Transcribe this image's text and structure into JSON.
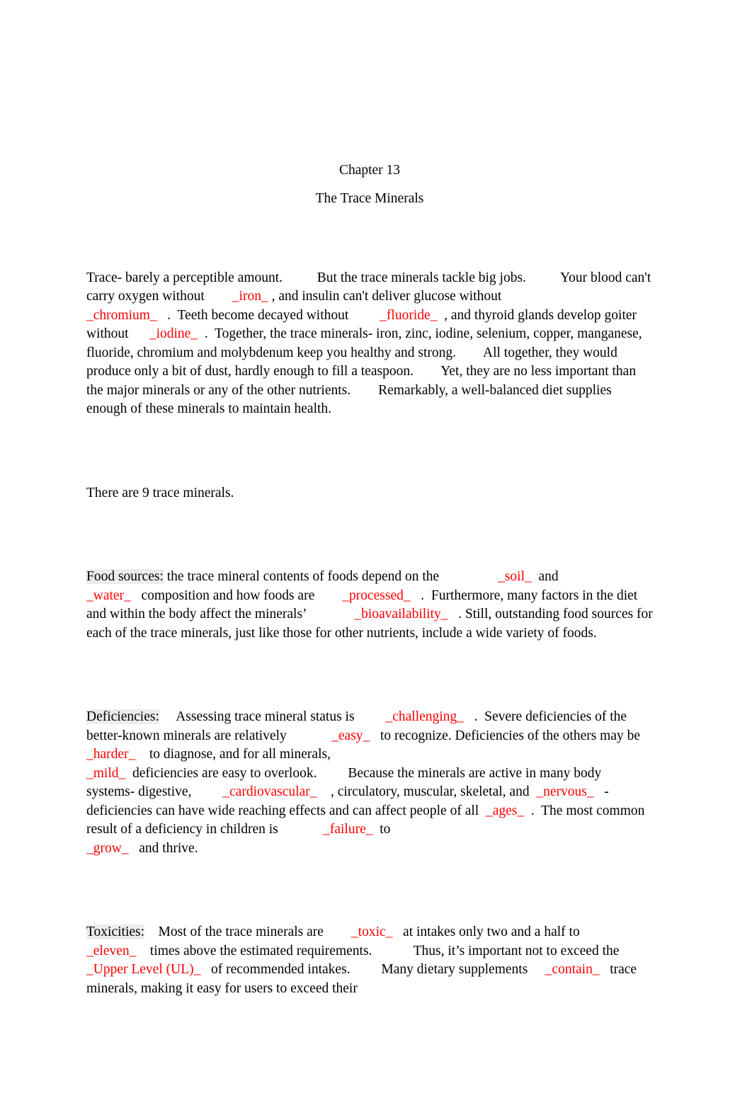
{
  "document": {
    "title_line_1": "Chapter 13",
    "title_line_2": "The Trace Minerals",
    "accent_color": "#FF0000",
    "highlight_color": "#ECECEC",
    "text_color": "#000000",
    "background_color": "#FFFFFF"
  },
  "paragraphs": {
    "intro": {
      "s1": "Trace- barely a perceptible amount.",
      "s2": "But the trace minerals tackle big jobs.",
      "s3": "Your blood can't carry oxygen without",
      "blank_1": "_iron_",
      "s4": ", and insulin can't deliver glucose without",
      "blank_2": "_chromium_",
      "s5": ".  Teeth become decayed without",
      "blank_3": "_fluoride_",
      "s6": ", and thyroid glands develop goiter without",
      "blank_4": "_iodine_",
      "s7": ".  Together, the trace minerals- iron, zinc, iodine, selenium, copper, manganese, fluoride, chromium and molybdenum keep you healthy and strong.",
      "s8": "All together, they would produce only a bit of dust, hardly enough to fill a teaspoon.",
      "s9": "Yet, they are no less important than the major minerals or any of the other nutrients.",
      "s10": "Remarkably, a well-balanced diet supplies enough of these minerals to maintain health."
    },
    "count": {
      "text": "There are 9 trace minerals."
    },
    "food_sources": {
      "heading": "Food sources:",
      "s1": " the trace mineral contents of foods depend on the",
      "blank_1": "_soil_",
      "s2": "and",
      "blank_2": "_water_",
      "s3": "composition and how foods are",
      "blank_3": "_processed_",
      "s4": ".  Furthermore, many factors in the diet and within the body affect the minerals’",
      "blank_4": "_bioavailability_",
      "s5": ". Still, outstanding food sources for each of the trace minerals, just like those for other nutrients, include a wide variety of foods."
    },
    "deficiencies": {
      "heading": "Deficiencies:",
      "s1": "Assessing trace mineral status is",
      "blank_1": "_challenging_",
      "s2": ".  Severe deficiencies of the better-known minerals are relatively",
      "blank_2": "_easy_",
      "s3": "to recognize. Deficiencies of the others may be",
      "blank_3": "_harder_",
      "s4": "to diagnose, and for all minerals,",
      "blank_4": "_mild_",
      "s5": "deficiencies are easy to overlook.",
      "s6": "Because the minerals are active in many body systems- digestive,",
      "blank_5": "_cardiovascular_",
      "s7": ", circulatory, muscular, skeletal, and",
      "blank_6": "_nervous_",
      "s8": "-deficiencies can have wide reaching effects and can affect people of all",
      "blank_7": "_ages_",
      "s9": ".  The most common result of a deficiency in children is",
      "blank_8": "_failure_",
      "s10": "to",
      "blank_9": "_grow_",
      "s11": "and thrive."
    },
    "toxicities": {
      "heading": "Toxicities:",
      "s1": "Most of the trace minerals are",
      "blank_1": "_toxic_",
      "s2": "at intakes only two and a half to",
      "blank_2": "_eleven_",
      "s3": "times above the estimated requirements.",
      "s4": "Thus, it’s important not to exceed the",
      "blank_3": "_Upper Level (UL)_",
      "s5": "of recommended intakes.",
      "s6": "Many dietary supplements",
      "blank_4": "_contain_",
      "s7": "trace minerals, making it easy for users to exceed their"
    }
  }
}
